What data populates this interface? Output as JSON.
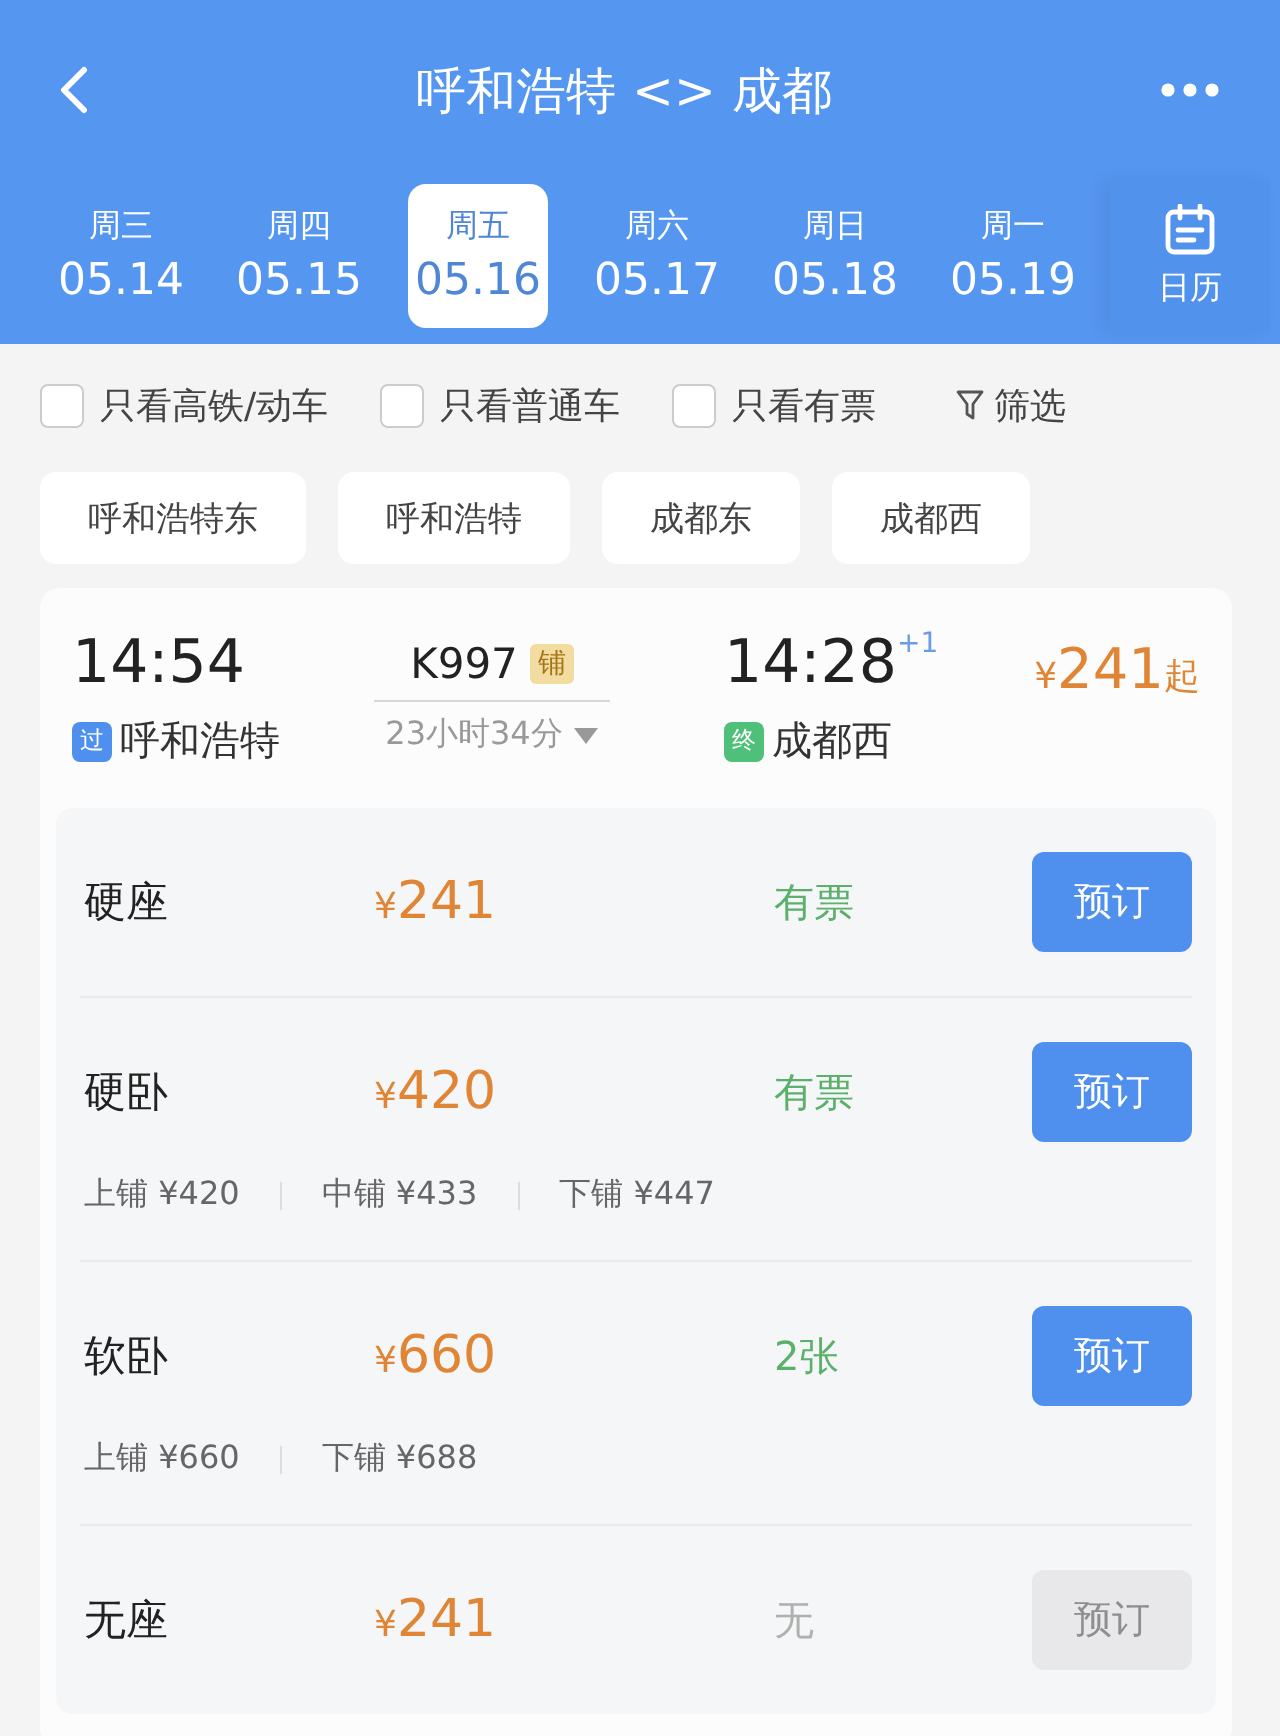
{
  "header": {
    "title": "呼和浩特 <> 成都"
  },
  "dates": [
    {
      "weekday": "周三",
      "date": "05.14",
      "selected": false
    },
    {
      "weekday": "周四",
      "date": "05.15",
      "selected": false
    },
    {
      "weekday": "周五",
      "date": "05.16",
      "selected": true
    },
    {
      "weekday": "周六",
      "date": "05.17",
      "selected": false
    },
    {
      "weekday": "周日",
      "date": "05.18",
      "selected": false
    },
    {
      "weekday": "周一",
      "date": "05.19",
      "selected": false
    }
  ],
  "calendar_label": "日历",
  "filters": [
    {
      "label": "只看高铁/动车",
      "checked": false
    },
    {
      "label": "只看普通车",
      "checked": false
    },
    {
      "label": "只看有票",
      "checked": false
    }
  ],
  "filter_button": "筛选",
  "stations": [
    "呼和浩特东",
    "呼和浩特",
    "成都东",
    "成都西"
  ],
  "train": {
    "depart_time": "14:54",
    "number": "K997",
    "tag": "铺",
    "arrive_time": "14:28",
    "day_offset": "+1",
    "price_symbol": "¥",
    "price": "241",
    "price_suffix": "起",
    "from_badge": "过",
    "from": "呼和浩特",
    "duration": "23小时34分",
    "to_badge": "终",
    "to": "成都西",
    "seats": [
      {
        "name": "硬座",
        "price_symbol": "¥",
        "price": "241",
        "availability": "有票",
        "available": true,
        "button": "预订"
      },
      {
        "name": "硬卧",
        "price_symbol": "¥",
        "price": "420",
        "availability": "有票",
        "available": true,
        "button": "预订",
        "berths": [
          "上铺 ¥420",
          "中铺 ¥433",
          "下铺 ¥447"
        ]
      },
      {
        "name": "软卧",
        "price_symbol": "¥",
        "price": "660",
        "availability": "2张",
        "available": true,
        "button": "预订",
        "berths": [
          "上铺 ¥660",
          "下铺 ¥688"
        ]
      },
      {
        "name": "无座",
        "price_symbol": "¥",
        "price": "241",
        "availability": "无",
        "available": false,
        "button": "预订"
      }
    ]
  }
}
